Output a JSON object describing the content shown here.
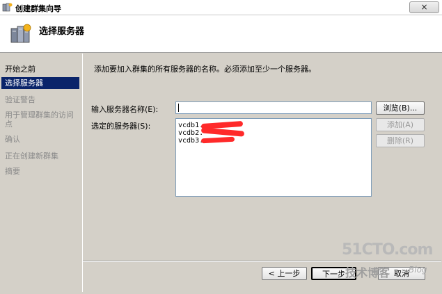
{
  "window": {
    "title": "创建群集向导",
    "close_symbol": "×"
  },
  "header": {
    "title": "选择服务器"
  },
  "nav": {
    "items": [
      {
        "label": "开始之前",
        "state": "done"
      },
      {
        "label": "选择服务器",
        "state": "active"
      },
      {
        "label": "验证警告",
        "state": "pending"
      },
      {
        "label": "用于管理群集的访问点",
        "state": "pending"
      },
      {
        "label": "确认",
        "state": "pending"
      },
      {
        "label": "正在创建新群集",
        "state": "pending"
      },
      {
        "label": "摘要",
        "state": "pending"
      }
    ]
  },
  "main": {
    "instruction": "添加要加入群集的所有服务器的名称。必须添加至少一个服务器。",
    "server_name_label": "输入服务器名称(E):",
    "server_name_value": "",
    "selected_label": "选定的服务器(S):",
    "selected_servers": [
      "vcdb1.",
      "vcdb2.",
      "vcdb3."
    ],
    "browse_button": "浏览(B)...",
    "add_button": "添加(A)",
    "remove_button": "删除(R)"
  },
  "footer": {
    "prev_button": "< 上一步",
    "next_button": "下一步",
    "cancel_button": "取消"
  },
  "watermark": {
    "site": "51CTO.com",
    "tagline": "技术博客",
    "blog": "Blog"
  },
  "colors": {
    "active_nav_bg": "#0a246a",
    "redaction": "#ff2a2a",
    "dialog_bg": "#d4d0c8"
  }
}
